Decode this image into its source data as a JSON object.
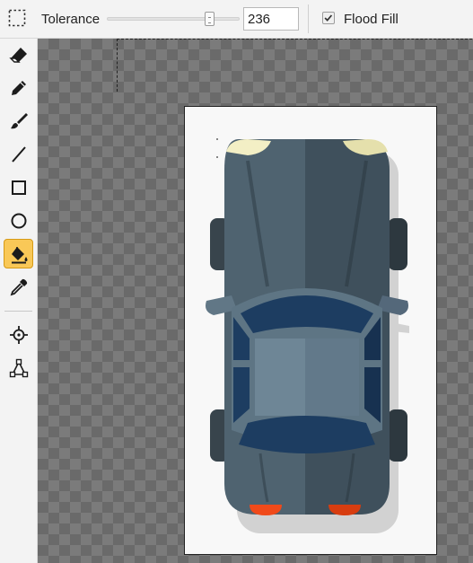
{
  "options_bar": {
    "tolerance_label": "Tolerance",
    "tolerance_value": "236",
    "tolerance_fraction": 0.93,
    "flood_fill_label": "Flood Fill",
    "flood_fill_checked": true
  },
  "toolbar": {
    "tools": [
      {
        "name": "eraser-icon",
        "active": false
      },
      {
        "name": "pencil-icon",
        "active": false
      },
      {
        "name": "brush-icon",
        "active": false
      },
      {
        "name": "line-icon",
        "active": false
      },
      {
        "name": "rectangle-icon",
        "active": false
      },
      {
        "name": "ellipse-icon",
        "active": false
      },
      {
        "name": "paint-bucket-icon",
        "active": true
      },
      {
        "name": "eyedropper-icon",
        "active": false
      },
      {
        "name": "pan-target-icon",
        "active": false
      },
      {
        "name": "node-path-icon",
        "active": false
      }
    ],
    "active_color": "#f9c857"
  },
  "canvas": {
    "image_subject": "car-top-view-illustration",
    "body_colors": [
      "#4f6370",
      "#3f505c"
    ],
    "glass_color": "#1d3d61",
    "headlight_color": "#f3efc5",
    "taillight_color": "#f04a1a"
  }
}
